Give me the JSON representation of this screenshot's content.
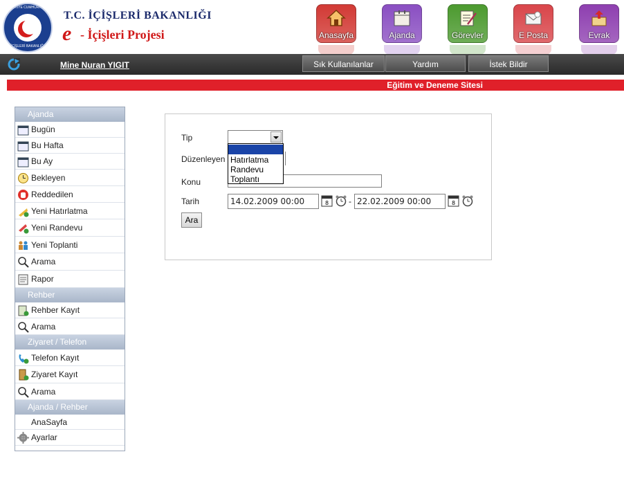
{
  "header": {
    "seal_top_text": "TÜRKİYE CUMHURİYETİ",
    "seal_bottom_text": "İÇİŞLERİ BAKANLIĞI",
    "ministry": "T.C. İÇİŞLERİ BAKANLIĞI",
    "project_e": "e",
    "project_name": "- İçişleri Projesi",
    "buttons": [
      {
        "label": "Anasayfa",
        "icon": "home-icon",
        "color": "#d23a35"
      },
      {
        "label": "Ajanda",
        "icon": "calendar-icon",
        "color": "#8a4fc2"
      },
      {
        "label": "Görevler",
        "icon": "tasks-icon",
        "color": "#4c9a2f"
      },
      {
        "label": "E Posta",
        "icon": "mail-icon",
        "color": "#d9454a"
      },
      {
        "label": "Evrak",
        "icon": "document-icon",
        "color": "#8e3fb0"
      }
    ]
  },
  "navbar": {
    "user": "Mine Nuran YIGIT",
    "buttons": [
      "Sık Kullanılanlar",
      "Yardım",
      "İstek Bildir"
    ]
  },
  "site_title": "Eğitim ve Deneme Sitesi",
  "sidebar": {
    "sections": [
      {
        "title": "Ajanda",
        "items": [
          {
            "label": "Bugün",
            "icon": "calendar-day-icon"
          },
          {
            "label": "Bu Hafta",
            "icon": "calendar-week-icon"
          },
          {
            "label": "Bu Ay",
            "icon": "calendar-month-icon"
          },
          {
            "label": "Bekleyen",
            "icon": "clock-icon"
          },
          {
            "label": "Reddedilen",
            "icon": "stop-hand-icon"
          },
          {
            "label": "Yeni Hatırlatma",
            "icon": "new-reminder-icon"
          },
          {
            "label": "Yeni Randevu",
            "icon": "new-appointment-icon"
          },
          {
            "label": "Yeni Toplanti",
            "icon": "new-meeting-icon"
          },
          {
            "label": "Arama",
            "icon": "search-icon"
          },
          {
            "label": "Rapor",
            "icon": "report-icon"
          }
        ]
      },
      {
        "title": "Rehber",
        "items": [
          {
            "label": "Rehber Kayıt",
            "icon": "contact-add-icon"
          },
          {
            "label": "Arama",
            "icon": "search-icon"
          }
        ]
      },
      {
        "title": "Ziyaret / Telefon",
        "items": [
          {
            "label": "Telefon Kayıt",
            "icon": "phone-icon"
          },
          {
            "label": "Ziyaret Kayıt",
            "icon": "visit-door-icon"
          },
          {
            "label": "Arama",
            "icon": "search-icon"
          }
        ]
      },
      {
        "title": "Ajanda / Rehber",
        "items": [
          {
            "label": "AnaSayfa",
            "icon": ""
          },
          {
            "label": "Ayarlar",
            "icon": "gear-icon"
          }
        ]
      }
    ]
  },
  "form": {
    "tip_label": "Tip",
    "tip_value": "",
    "tip_options": [
      "",
      "Hatırlatma",
      "Randevu",
      "Toplantı"
    ],
    "duzenleyen_label": "Düzenleyen",
    "konu_label": "Konu",
    "konu_value": "",
    "tarih_label": "Tarih",
    "date_from": "14.02.2009 00:00",
    "date_separator": "-",
    "date_to": "22.02.2009 00:00",
    "search_button": "Ara"
  }
}
